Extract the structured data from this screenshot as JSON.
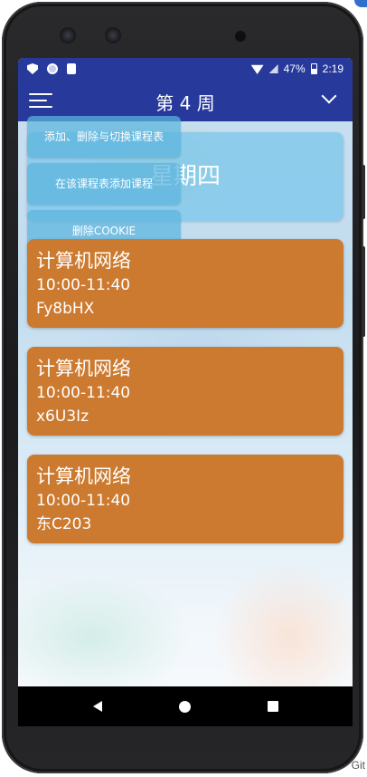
{
  "status_bar": {
    "battery": "47%",
    "time": "2:19"
  },
  "app_bar": {
    "title": "第 4 周",
    "left_icon": "menu-icon",
    "right_icon": "chevron-down-icon"
  },
  "day": {
    "label": "星期四"
  },
  "popup_menu": {
    "items": [
      {
        "label": "添加、删除与切换课程表"
      },
      {
        "label": "在该课程表添加课程"
      },
      {
        "label": "删除COOKIE"
      }
    ]
  },
  "courses": [
    {
      "name": "计算机网络",
      "time": "10:00-11:40",
      "room": "Fy8bHX"
    },
    {
      "name": "计算机网络",
      "time": "10:00-11:40",
      "room": "x6U3Iz"
    },
    {
      "name": "计算机网络",
      "time": "10:00-11:40",
      "room": "东C203"
    }
  ],
  "colors": {
    "primary": "#273a9c",
    "course_card": "#cc7a30",
    "day_card": "#7ec6ea",
    "menu_button": "#5cb4de"
  },
  "corner_label": "Git"
}
